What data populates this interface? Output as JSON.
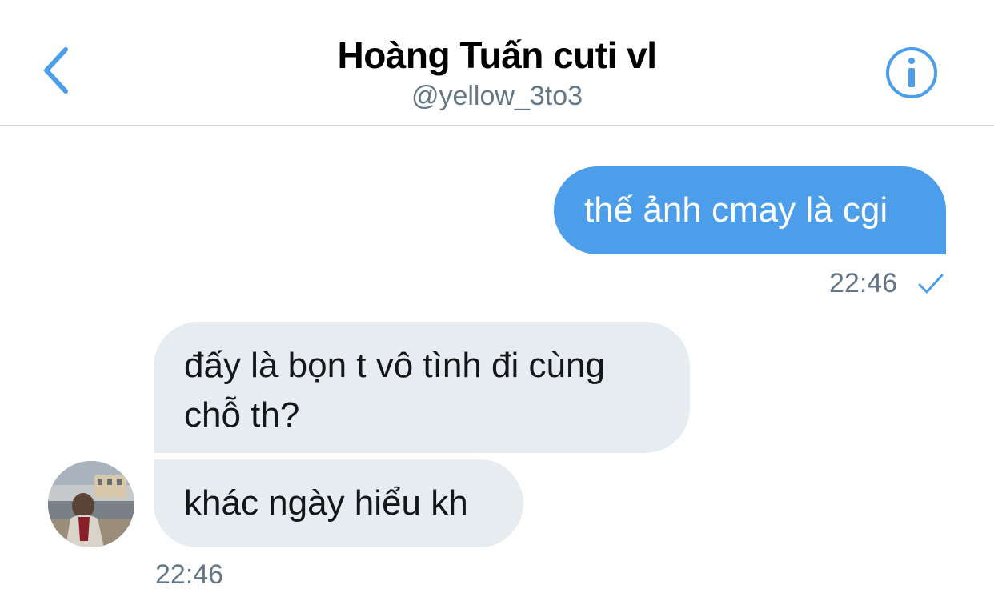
{
  "header": {
    "title": "Hoàng Tuấn cuti vl",
    "handle": "@yellow_3to3",
    "back_icon": "chevron-left-icon",
    "info_icon": "info-icon",
    "accent_color": "#4c9eea"
  },
  "messages": [
    {
      "direction": "sent",
      "text": "thế ảnh cmay là cgi"
    },
    {
      "direction": "received",
      "text": "đấy là bọn t vô tình đi cùng chỗ th?"
    },
    {
      "direction": "received",
      "text": "khác ngày hiểu kh"
    }
  ],
  "timestamps": {
    "sent": "22:46",
    "sent_status_icon": "check-icon",
    "received": "22:46"
  },
  "colors": {
    "sent_bubble": "#4c9eea",
    "received_bubble": "#e6ecf0",
    "timestamp": "#657786"
  }
}
